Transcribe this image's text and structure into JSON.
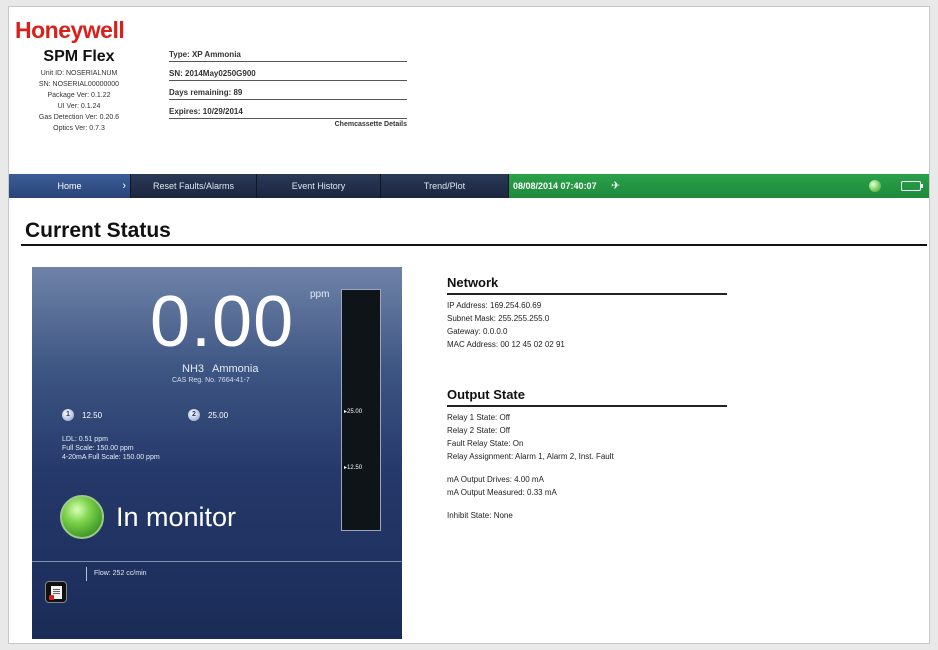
{
  "header": {
    "logo": "Honeywell",
    "product": "SPM Flex",
    "info_lines": [
      "Unit ID: NOSERIALNUM",
      "SN: NOSERIAL00000000",
      "Package Ver: 0.1.22",
      "UI Ver: 0.1.24",
      "Gas Detection Ver: 0.20.6",
      "Optics Ver: 0.7.3"
    ],
    "cassette": {
      "type": "Type: XP Ammonia",
      "sn": "SN: 2014May0250G900",
      "days_remaining": "Days remaining: 89",
      "expires": "Expires: 10/29/2014",
      "details_link": "Chemcassette Details"
    }
  },
  "nav": {
    "home": "Home",
    "reset": "Reset Faults/Alarms",
    "event_history": "Event History",
    "trend": "Trend/Plot",
    "datetime": "08/08/2014 07:40:07"
  },
  "page": {
    "title": "Current Status"
  },
  "gas": {
    "reading": "0.00",
    "unit": "ppm",
    "formula": "NH3",
    "name": "Ammonia",
    "cas": "CAS Reg. No. 7664-41-7",
    "alarm1_label": "1",
    "alarm1_value": "12.50",
    "alarm2_label": "2",
    "alarm2_value": "25.00",
    "gauge_hi": "25.00",
    "gauge_lo": "12.50",
    "gauge_fill_fraction": 0,
    "specs": [
      "LDL: 0.51 ppm",
      "Full Scale: 150.00 ppm",
      "4-20mA Full Scale: 150.00 ppm"
    ],
    "state": "In monitor",
    "flow": "Flow: 252 cc/min"
  },
  "network": {
    "title": "Network",
    "lines": [
      "IP Address: 169.254.60.69",
      "Subnet Mask: 255.255.255.0",
      "Gateway: 0.0.0.0",
      "MAC Address: 00 12 45 02 02 91"
    ]
  },
  "output": {
    "title": "Output State",
    "relay_lines": [
      "Relay 1 State: Off",
      "Relay 2 State: Off",
      "Fault Relay State: On",
      "Relay Assignment: Alarm 1, Alarm 2, Inst. Fault"
    ],
    "ma_lines": [
      "mA Output Drives: 4.00 mA",
      "mA Output Measured: 0.33 mA"
    ],
    "inhibit": "Inhibit State: None"
  },
  "colors": {
    "brand_red": "#d9211c",
    "status_green": "#1e8a3b",
    "nav_dark": "#1b2540",
    "nav_active": "#2a4578"
  }
}
